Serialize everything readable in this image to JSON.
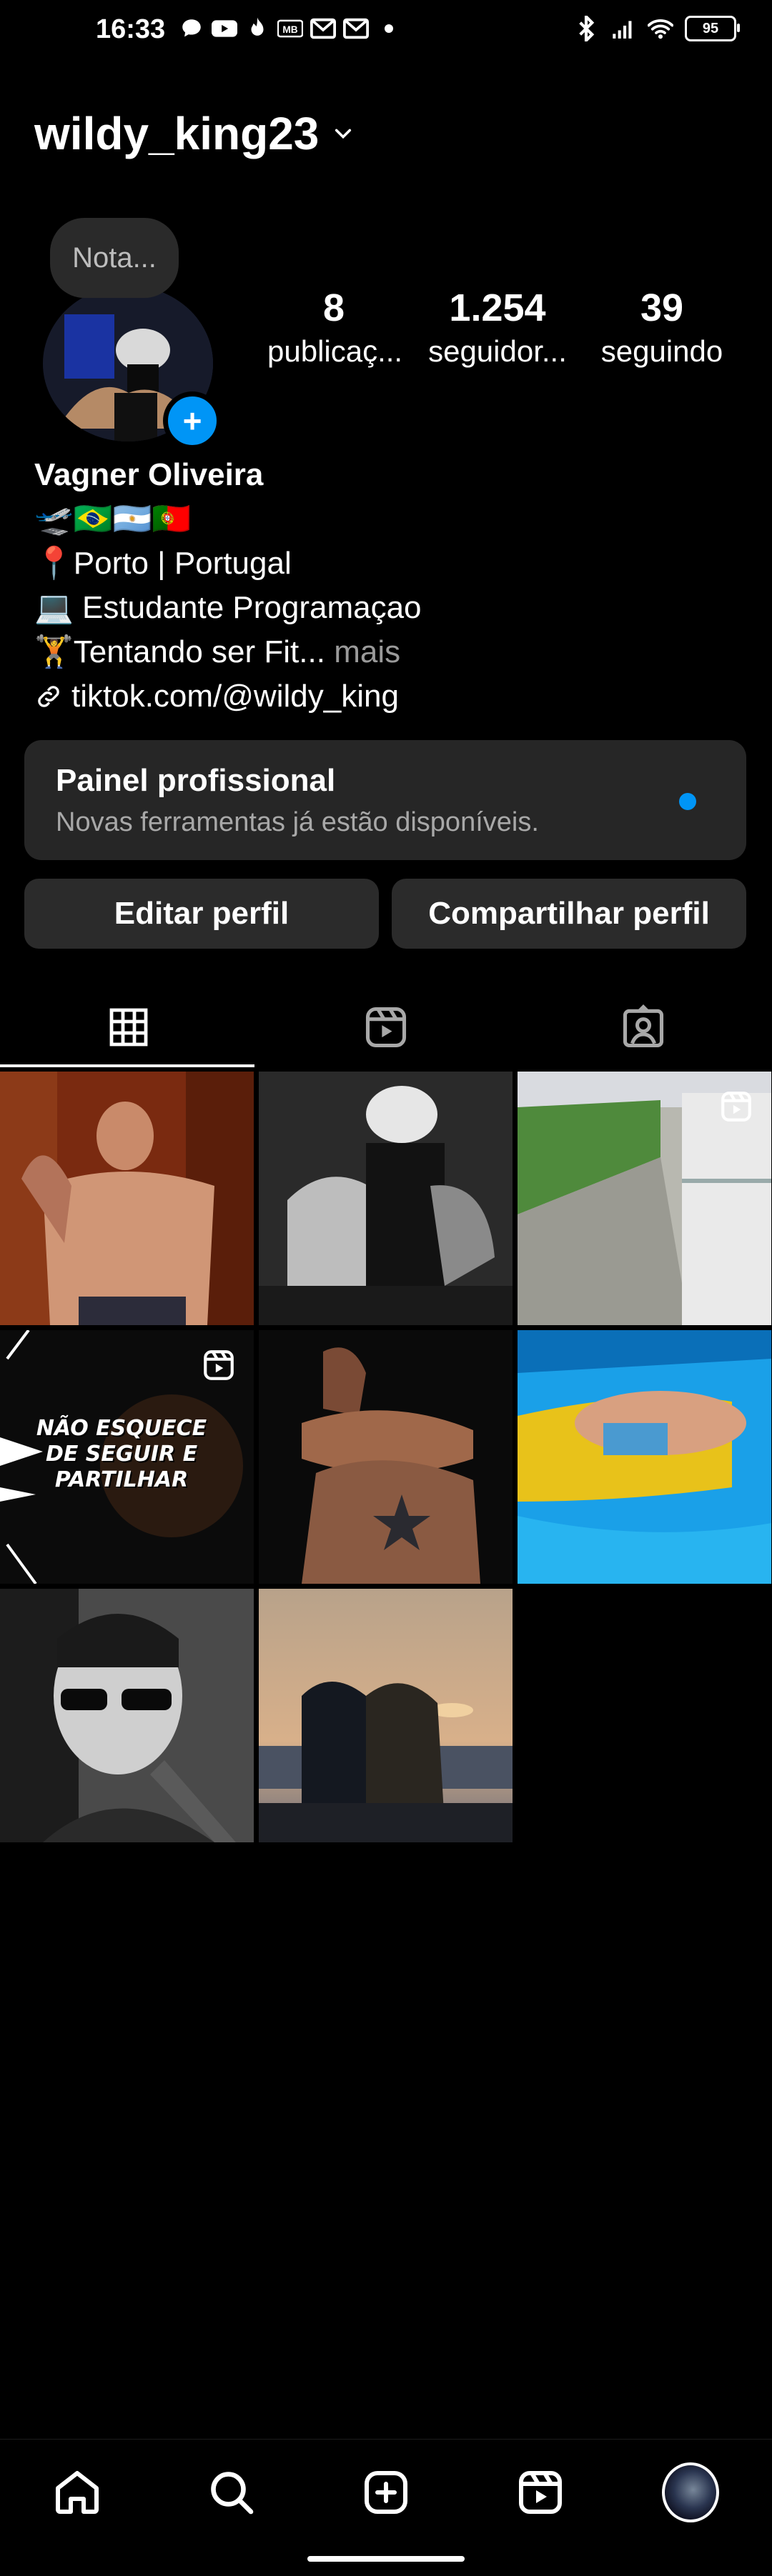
{
  "status_bar": {
    "time": "16:33",
    "battery": "95"
  },
  "header": {
    "username": "wildy_king23"
  },
  "note": {
    "placeholder": "Nota..."
  },
  "stats": [
    {
      "num": "8",
      "label": "publicaç..."
    },
    {
      "num": "1.254",
      "label": "seguidor..."
    },
    {
      "num": "39",
      "label": "seguindo"
    }
  ],
  "bio": {
    "name": "Vagner Oliveira",
    "flags": "🛫🇧🇷🇦🇷🇵🇹",
    "line1": "📍Porto | Portugal",
    "line2": "💻 Estudante Programaçao",
    "line3": "🏋Tentando ser Fit...",
    "more": " mais",
    "link": "tiktok.com/@wildy_king"
  },
  "panel": {
    "title": "Painel profissional",
    "subtitle": "Novas ferramentas já estão disponíveis."
  },
  "buttons": {
    "edit": "Editar perfil",
    "share": "Compartilhar perfil"
  },
  "posts": {
    "reel_caption": "NÃO ESQUECE DE SEGUIR E PARTILHAR"
  },
  "colors": {
    "accent": "#0095f6",
    "panel_bg": "#262626",
    "button_bg": "#2b2b2b"
  }
}
